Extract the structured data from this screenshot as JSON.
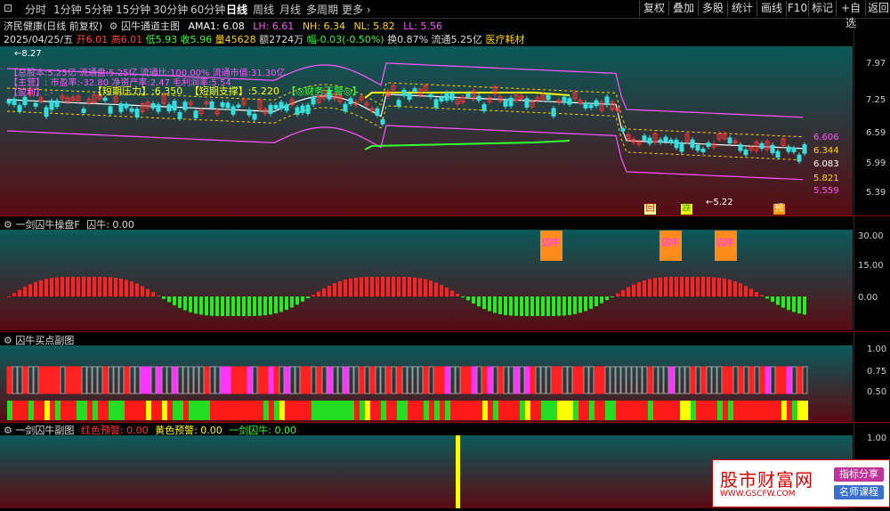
{
  "toolbar": {
    "periods": [
      "分时",
      "1分钟",
      "5分钟",
      "15分钟",
      "30分钟",
      "60分钟",
      "日线",
      "周线",
      "月线",
      "多周期",
      "更多"
    ],
    "active_period": "日线",
    "right_buttons": [
      "复权",
      "叠加",
      "多股",
      "统计",
      "画线",
      "F10",
      "标记",
      "+自选",
      "返回"
    ]
  },
  "stock": {
    "name_line": "济民健康(日线 前复权)",
    "indicator_name": "囚牛通道主图",
    "ama": "AMA1: 6.08",
    "lh": "LH: 6.61",
    "nh": "NH: 6.34",
    "nl": "NL: 5.82",
    "ll": "LL: 5.56"
  },
  "quote": {
    "date": "2025/04/25/五",
    "open": "开6.01",
    "high": "高6.01",
    "low": "低5.93",
    "close": "收5.96",
    "volume": "量45628",
    "amount": "额2724万",
    "change": "幅-0.03(-0.50%)",
    "turnover": "换0.87%",
    "float": "流通5.25亿",
    "sector": "医疗耗材"
  },
  "main_chart": {
    "price_top_label": "8.27",
    "overlay_lines": [
      "【总股本:5.25亿  流通盘:5.25亿  流通比:100.00%  流通市值:31.30亿",
      "【主营】:  市盈率:-32.80  净资产率:2.47  毛利润率:5.54",
      "【盈利】: -"
    ],
    "pressure": "【短期压力】:6.350",
    "support": "【短期支撑】:5.220",
    "finance": "【◎财务无警◎】",
    "low_marker": "5.22",
    "markers": [
      "回",
      "跌",
      "预"
    ],
    "scale": [
      "7.97",
      "7.25",
      "6.59",
      "5.99",
      "5.39"
    ],
    "right_values": [
      {
        "text": "6.606",
        "color": "#ff55ff"
      },
      {
        "text": "6.344",
        "color": "#ffd700"
      },
      {
        "text": "6.083",
        "color": "#ffffff"
      },
      {
        "text": "5.821",
        "color": "#ffd700"
      },
      {
        "text": "5.559",
        "color": "#ff55ff"
      }
    ]
  },
  "panel_f": {
    "title": "一剑囚牛操盘F",
    "value_label": "囚牛: 0.00",
    "scale": [
      "30.00",
      "15.00",
      "0.00"
    ],
    "tags": [
      "囚牛",
      "囚牛",
      "囚牛"
    ]
  },
  "panel_buy": {
    "title": "囚牛买点副图",
    "scale": [
      "1.00",
      "0.75",
      "0.50"
    ]
  },
  "panel_last": {
    "title": "一剑囚牛副图",
    "red_warn": "红色预警: 0.00",
    "yellow_warn": "黄色预警: 0.00",
    "qiuniu": "一剑囚牛: 0.00",
    "scale": [
      "1.00"
    ]
  },
  "watermark": {
    "title": "股市财富网",
    "url": "WWW.GSCFW.COM",
    "tag1": "指标分享",
    "tag2": "名师课程"
  }
}
